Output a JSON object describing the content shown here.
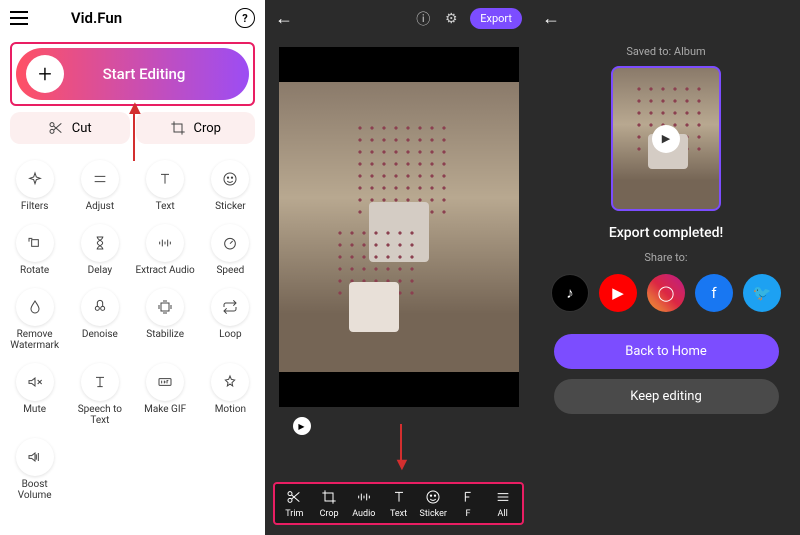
{
  "panel1": {
    "app_title": "Vid.Fun",
    "start_label": "Start Editing",
    "cut_label": "Cut",
    "crop_label": "Crop",
    "tools": [
      {
        "icon": "sparkle",
        "label": "Filters"
      },
      {
        "icon": "sliders",
        "label": "Adjust"
      },
      {
        "icon": "text",
        "label": "Text"
      },
      {
        "icon": "smile",
        "label": "Sticker"
      },
      {
        "icon": "rotate",
        "label": "Rotate"
      },
      {
        "icon": "hourglass",
        "label": "Delay"
      },
      {
        "icon": "extract-audio",
        "label": "Extract Audio"
      },
      {
        "icon": "speed",
        "label": "Speed"
      },
      {
        "icon": "water",
        "label": "Remove Watermark"
      },
      {
        "icon": "denoise",
        "label": "Denoise"
      },
      {
        "icon": "stabilize",
        "label": "Stabilize"
      },
      {
        "icon": "loop",
        "label": "Loop"
      },
      {
        "icon": "mute",
        "label": "Mute"
      },
      {
        "icon": "speech",
        "label": "Speech to Text"
      },
      {
        "icon": "gif",
        "label": "Make GIF"
      },
      {
        "icon": "motion",
        "label": "Motion"
      },
      {
        "icon": "boost",
        "label": "Boost Volume"
      }
    ]
  },
  "panel2": {
    "export_label": "Export",
    "toolbar": [
      {
        "icon": "scissors",
        "label": "Trim"
      },
      {
        "icon": "crop",
        "label": "Crop"
      },
      {
        "icon": "audio",
        "label": "Audio"
      },
      {
        "icon": "text",
        "label": "Text"
      },
      {
        "icon": "smile",
        "label": "Sticker"
      },
      {
        "icon": "f",
        "label": "F"
      },
      {
        "icon": "all",
        "label": "All"
      }
    ]
  },
  "panel3": {
    "saved_to": "Saved to: Album",
    "complete": "Export completed!",
    "share_label": "Share to:",
    "social": [
      "tiktok",
      "youtube",
      "instagram",
      "facebook",
      "twitter"
    ],
    "back_home": "Back to Home",
    "keep_editing": "Keep editing"
  }
}
